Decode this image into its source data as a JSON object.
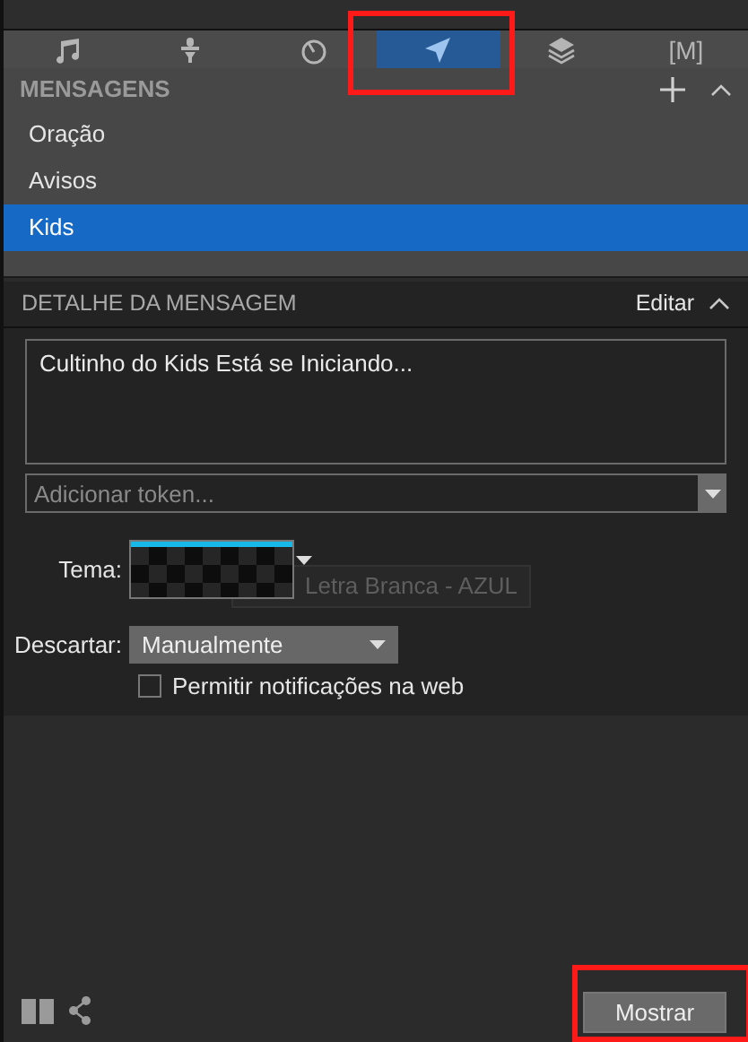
{
  "tabs": [
    {
      "kind": "music",
      "selected": false
    },
    {
      "kind": "mic",
      "selected": false
    },
    {
      "kind": "timer",
      "selected": false
    },
    {
      "kind": "send",
      "selected": true
    },
    {
      "kind": "layers",
      "selected": false
    },
    {
      "kind": "macro",
      "label": "[M]",
      "selected": false
    }
  ],
  "messages": {
    "title": "MENSAGENS",
    "items": [
      {
        "label": "Oração",
        "selected": false
      },
      {
        "label": "Avisos",
        "selected": false
      },
      {
        "label": "Kids",
        "selected": true
      }
    ]
  },
  "detail": {
    "title": "DETALHE DA MENSAGEM",
    "edit_label": "Editar",
    "message_text": "Cultinho do Kids Está se Iniciando...",
    "token": {
      "placeholder": "Adicionar token..."
    },
    "theme": {
      "label": "Tema:",
      "tooltip": "Letra Branca - AZUL"
    },
    "dismiss": {
      "label": "Descartar:",
      "value": "Manualmente"
    },
    "web_notifications": {
      "label": "Permitir notificações na web",
      "checked": false
    }
  },
  "show_button": "Mostrar"
}
